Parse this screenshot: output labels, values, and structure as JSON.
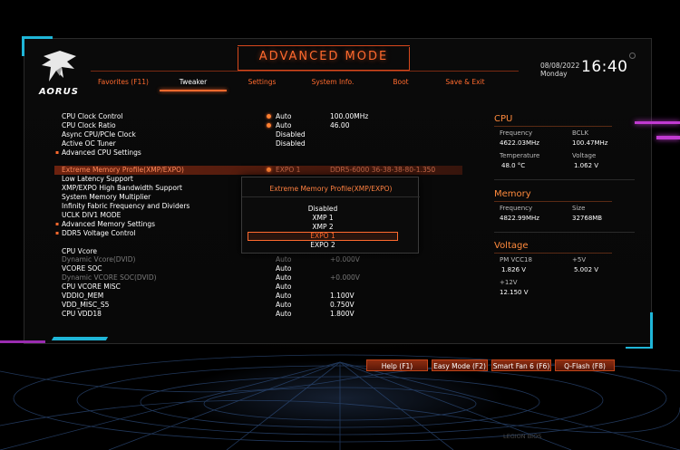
{
  "header": {
    "logo_text": "AORUS",
    "mode_title": "ADVANCED MODE",
    "date": "08/08/2022",
    "day": "Monday",
    "time": "16:40"
  },
  "tabs": [
    {
      "label": "Favorites (F11)",
      "active": false
    },
    {
      "label": "Tweaker",
      "active": true
    },
    {
      "label": "Settings",
      "active": false
    },
    {
      "label": "System Info.",
      "active": false
    },
    {
      "label": "Boot",
      "active": false
    },
    {
      "label": "Save & Exit",
      "active": false
    }
  ],
  "settings": {
    "group1": [
      {
        "label": "CPU Clock Control",
        "value": "Auto",
        "value2": "100.00MHz",
        "dot": true
      },
      {
        "label": "CPU Clock Ratio",
        "value": "Auto",
        "value2": "46.00",
        "dot": true
      },
      {
        "label": "Async CPU/PCIe Clock",
        "value": "Disabled",
        "value2": ""
      },
      {
        "label": "Active OC Tuner",
        "value": "Disabled",
        "value2": ""
      },
      {
        "label": "Advanced CPU Settings",
        "value": "",
        "value2": "",
        "sub": true
      }
    ],
    "group2": [
      {
        "label": "Extreme Memory Profile(XMP/EXPO)",
        "value": "EXPO 1",
        "value2": "DDR5-6000 36-38-38-80-1.350",
        "dot": true,
        "highlight": true
      },
      {
        "label": "Low Latency Support",
        "value": "",
        "value2": ""
      },
      {
        "label": "XMP/EXPO High Bandwidth Support",
        "value": "",
        "value2": ""
      },
      {
        "label": "System Memory Multiplier",
        "value": "",
        "value2": ""
      },
      {
        "label": "Infinity Fabric Frequency and Dividers",
        "value": "",
        "value2": ""
      },
      {
        "label": "UCLK DIV1 MODE",
        "value": "",
        "value2": ""
      },
      {
        "label": "Advanced Memory Settings",
        "value": "",
        "value2": "",
        "sub": true
      },
      {
        "label": "DDR5 Voltage Control",
        "value": "",
        "value2": "",
        "sub": true
      }
    ],
    "group3": [
      {
        "label": "CPU Vcore",
        "value": "",
        "value2": ""
      },
      {
        "label": "Dynamic Vcore(DVID)",
        "value": "Auto",
        "value2": "+0.000V",
        "dim": true
      },
      {
        "label": "VCORE SOC",
        "value": "Auto",
        "value2": ""
      },
      {
        "label": "Dynamic VCORE SOC(DVID)",
        "value": "Auto",
        "value2": "+0.000V",
        "dim": true
      },
      {
        "label": "CPU VCORE MISC",
        "value": "Auto",
        "value2": ""
      },
      {
        "label": "VDDIO_MEM",
        "value": "Auto",
        "value2": "1.100V"
      },
      {
        "label": "VDD_MISC_S5",
        "value": "Auto",
        "value2": "0.750V"
      },
      {
        "label": "CPU VDD18",
        "value": "Auto",
        "value2": "1.800V"
      }
    ]
  },
  "popup": {
    "title": "Extreme Memory Profile(XMP/EXPO)",
    "options": [
      "Disabled",
      "XMP 1",
      "XMP 2",
      "EXPO 1",
      "EXPO 2"
    ],
    "selected_index": 3
  },
  "cpu": {
    "title": "CPU",
    "frequency_label": "Frequency",
    "frequency_value": "4622.03MHz",
    "bclk_label": "BCLK",
    "bclk_value": "100.47MHz",
    "temperature_label": "Temperature",
    "temperature_value": "48.0 °C",
    "voltage_label": "Voltage",
    "voltage_value": "1.062 V"
  },
  "memory": {
    "title": "Memory",
    "frequency_label": "Frequency",
    "frequency_value": "4822.99MHz",
    "size_label": "Size",
    "size_value": "32768MB"
  },
  "voltage": {
    "title": "Voltage",
    "pmvcc18_label": "PM VCC18",
    "pmvcc18_value": "1.826 V",
    "p5v_label": "+5V",
    "p5v_value": "5.002 V",
    "p12v_label": "+12V",
    "p12v_value": "12.150 V"
  },
  "bottom_buttons": [
    {
      "label": "Help (F1)"
    },
    {
      "label": "Easy Mode (F2)"
    },
    {
      "label": "Smart Fan 6 (F6)"
    },
    {
      "label": "Q-Flash (F8)"
    }
  ],
  "watermark": "LEGION BIOS",
  "colors": {
    "accent": "#ff6a2e",
    "highlight_row": "#be3714",
    "frame_cyan": "#1fb6d8",
    "streak_magenta": "#c03ad0"
  }
}
